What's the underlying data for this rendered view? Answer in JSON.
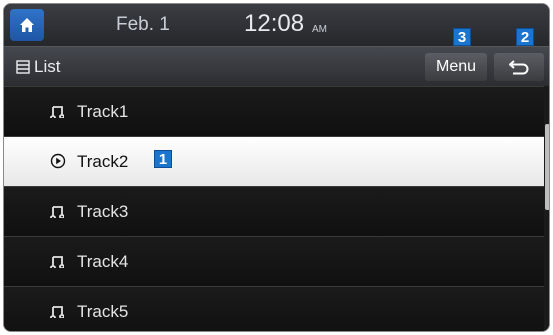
{
  "status_bar": {
    "date": "Feb. 1",
    "time": "12:08",
    "ampm": "AM"
  },
  "toolbar": {
    "title": "List",
    "menu_label": "Menu"
  },
  "callouts": {
    "track_selected": "1",
    "back": "2",
    "menu": "3"
  },
  "tracks": [
    {
      "label": "Track1",
      "icon": "music-note-icon"
    },
    {
      "label": "Track2",
      "icon": "play-circle-icon",
      "selected": true
    },
    {
      "label": "Track3",
      "icon": "music-note-icon"
    },
    {
      "label": "Track4",
      "icon": "music-note-icon"
    },
    {
      "label": "Track5",
      "icon": "music-note-icon"
    }
  ],
  "colors": {
    "accent": "#1f5fb0",
    "selected_row": "#ffffff"
  }
}
